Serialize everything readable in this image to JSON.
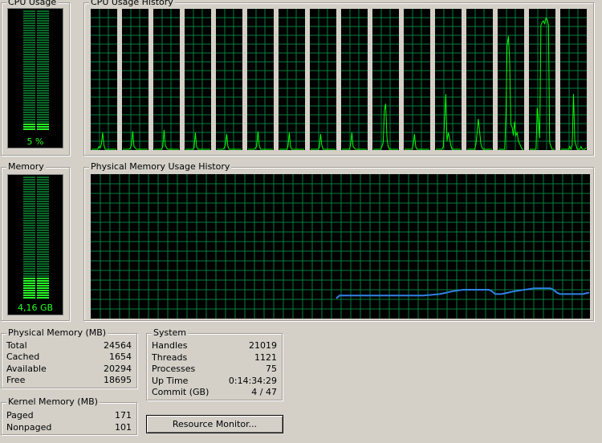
{
  "cpu_usage": {
    "title": "CPU Usage",
    "value_label": "5 %",
    "level": 0.05
  },
  "cpu_history": {
    "title": "CPU Usage History",
    "grid_color": "#008040",
    "line_color": "#00ff00",
    "cores": [
      [
        0,
        0,
        0,
        0,
        0,
        0,
        2,
        1,
        4,
        12,
        3,
        0,
        0,
        0,
        0,
        0,
        0,
        0,
        0,
        0,
        0
      ],
      [
        0,
        0,
        0,
        0,
        0,
        0,
        1,
        3,
        13,
        2,
        1,
        0,
        0,
        0,
        0,
        0,
        0,
        0,
        0,
        0,
        0
      ],
      [
        0,
        0,
        0,
        0,
        0,
        0,
        0,
        2,
        14,
        3,
        1,
        0,
        0,
        0,
        0,
        0,
        0,
        0,
        0,
        0,
        0
      ],
      [
        0,
        0,
        0,
        0,
        0,
        0,
        0,
        1,
        12,
        2,
        0,
        0,
        0,
        0,
        0,
        0,
        0,
        0,
        0,
        0,
        0
      ],
      [
        0,
        0,
        0,
        0,
        0,
        0,
        1,
        3,
        11,
        2,
        0,
        0,
        0,
        0,
        0,
        0,
        0,
        0,
        0,
        0,
        0
      ],
      [
        0,
        0,
        0,
        0,
        0,
        0,
        1,
        2,
        13,
        3,
        0,
        0,
        0,
        0,
        0,
        0,
        0,
        0,
        0,
        0,
        0
      ],
      [
        0,
        0,
        0,
        0,
        0,
        0,
        0,
        2,
        12,
        2,
        0,
        0,
        0,
        0,
        0,
        0,
        0,
        0,
        0,
        0,
        0
      ],
      [
        0,
        0,
        0,
        0,
        0,
        0,
        0,
        1,
        11,
        3,
        0,
        0,
        0,
        0,
        0,
        0,
        0,
        0,
        0,
        0,
        0
      ],
      [
        0,
        0,
        0,
        0,
        0,
        0,
        0,
        3,
        12,
        2,
        1,
        0,
        0,
        0,
        0,
        0,
        0,
        0,
        0,
        0,
        0
      ],
      [
        0,
        0,
        0,
        0,
        0,
        0,
        0,
        2,
        5,
        28,
        33,
        8,
        2,
        0,
        0,
        0,
        0,
        0,
        0,
        0,
        0
      ],
      [
        0,
        0,
        0,
        0,
        0,
        0,
        0,
        3,
        11,
        2,
        0,
        0,
        0,
        0,
        0,
        0,
        0,
        0,
        0,
        0,
        0
      ],
      [
        0,
        0,
        0,
        0,
        0,
        0,
        2,
        20,
        40,
        6,
        12,
        8,
        3,
        0,
        0,
        0,
        0,
        0,
        0,
        0,
        0
      ],
      [
        0,
        0,
        0,
        0,
        0,
        0,
        0,
        3,
        12,
        22,
        13,
        4,
        1,
        0,
        0,
        0,
        0,
        0,
        0,
        0,
        0
      ],
      [
        0,
        0,
        0,
        0,
        0,
        0,
        25,
        75,
        82,
        65,
        18,
        16,
        10,
        20,
        10,
        12,
        6,
        4,
        2,
        0,
        0
      ],
      [
        0,
        0,
        0,
        0,
        0,
        0,
        30,
        22,
        8,
        90,
        92,
        93,
        91,
        95,
        94,
        90,
        5,
        2,
        0,
        0,
        0
      ],
      [
        0,
        0,
        0,
        0,
        0,
        0,
        0,
        2,
        0,
        3,
        40,
        6,
        3,
        0,
        0,
        0,
        2,
        0,
        0,
        0,
        1
      ]
    ]
  },
  "memory": {
    "title": "Memory",
    "value_label": "4,16 GB",
    "level": 0.17
  },
  "memory_history": {
    "title": "Physical Memory Usage History",
    "line_color": "#2f82e6",
    "values": [
      14,
      16,
      16,
      16,
      16,
      16,
      16,
      16,
      16,
      16,
      16,
      16,
      16,
      16,
      16,
      16,
      16,
      16,
      16,
      16,
      16,
      16,
      16,
      16,
      16,
      16,
      16,
      16,
      16.2,
      16.4,
      16.6,
      16.8,
      17,
      17.5,
      18,
      18.5,
      19,
      19.3,
      19.6,
      20,
      20,
      20,
      20,
      20,
      20,
      20,
      20,
      20,
      19,
      17,
      17,
      17,
      17.5,
      18,
      18.5,
      19,
      19.3,
      19.6,
      20,
      20.3,
      20.6,
      21,
      21,
      21,
      21,
      21,
      21,
      20,
      18,
      17,
      17,
      17,
      17,
      17,
      17,
      17,
      17,
      17.5,
      18
    ]
  },
  "physical_memory": {
    "title": "Physical Memory (MB)",
    "rows": [
      {
        "label": "Total",
        "value": "24564"
      },
      {
        "label": "Cached",
        "value": "1654"
      },
      {
        "label": "Available",
        "value": "20294"
      },
      {
        "label": "Free",
        "value": "18695"
      }
    ]
  },
  "kernel_memory": {
    "title": "Kernel Memory (MB)",
    "rows": [
      {
        "label": "Paged",
        "value": "171"
      },
      {
        "label": "Nonpaged",
        "value": "101"
      }
    ]
  },
  "system": {
    "title": "System",
    "rows": [
      {
        "label": "Handles",
        "value": "21019"
      },
      {
        "label": "Threads",
        "value": "1121"
      },
      {
        "label": "Processes",
        "value": "75"
      },
      {
        "label": "Up Time",
        "value": "0:14:34:29"
      },
      {
        "label": "Commit (GB)",
        "value": "4 / 47"
      }
    ]
  },
  "resource_monitor_button": {
    "label": "Resource Monitor..."
  }
}
